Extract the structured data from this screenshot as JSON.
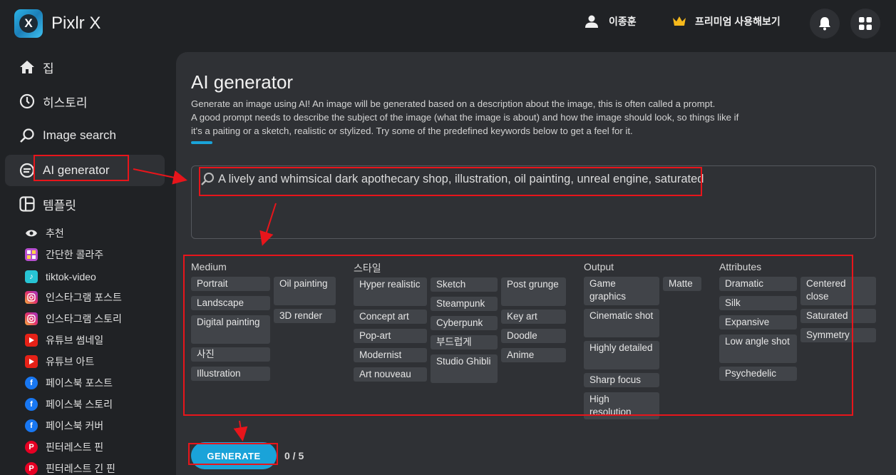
{
  "app": {
    "name": "Pixlr X",
    "logo_letter": "X"
  },
  "topbar": {
    "user_name": "이종훈",
    "premium_label": "프리미엄 사용해보기"
  },
  "sidebar": {
    "items": [
      {
        "label": "집",
        "icon": "home-icon"
      },
      {
        "label": "히스토리",
        "icon": "clock-icon"
      },
      {
        "label": "Image search",
        "icon": "search-icon"
      },
      {
        "label": "AI generator",
        "icon": "ai-icon",
        "active": true
      },
      {
        "label": "템플릿",
        "icon": "template-icon"
      }
    ],
    "templates": [
      {
        "label": "추천",
        "icon": "eye-icon"
      },
      {
        "label": "간단한 콜라주",
        "icon": "collage-icon"
      },
      {
        "label": "tiktok-video",
        "icon": "tiktok-icon"
      },
      {
        "label": "인스타그램 포스트",
        "icon": "instagram-icon"
      },
      {
        "label": "인스타그램 스토리",
        "icon": "instagram-icon"
      },
      {
        "label": "유튜브 썸네일",
        "icon": "youtube-icon"
      },
      {
        "label": "유튜브 아트",
        "icon": "youtube-icon"
      },
      {
        "label": "페이스북 포스트",
        "icon": "facebook-icon"
      },
      {
        "label": "페이스북 스토리",
        "icon": "facebook-icon"
      },
      {
        "label": "페이스북 커버",
        "icon": "facebook-icon"
      },
      {
        "label": "핀터레스트 핀",
        "icon": "pinterest-icon"
      },
      {
        "label": "핀터레스트 긴 핀",
        "icon": "pinterest-icon"
      }
    ]
  },
  "main": {
    "title": "AI generator",
    "description_1": "Generate an image using AI! An image will be generated based on a description about the image, this is often called a prompt.",
    "description_2": "A good prompt needs to describe the subject of the image (what the image is about) and how the image should look, so things like if",
    "description_3": "it's a paiting or a sketch, realistic or stylized. Try some of the predefined keywords below to get a feel for it.",
    "prompt": "A lively and whimsical dark apothecary shop, illustration, oil painting, unreal engine, saturated",
    "categories": {
      "medium": {
        "title": "Medium",
        "chips": [
          "Portrait",
          "Landscape",
          "Digital painting",
          "사진",
          "Illustration",
          "Oil painting",
          "3D render"
        ]
      },
      "style": {
        "title": "스타일",
        "chips": [
          "Hyper realistic",
          "Concept art",
          "Pop-art",
          "Modernist",
          "Art nouveau",
          "Sketch",
          "Steampunk",
          "Cyberpunk",
          "부드럽게",
          "Studio Ghibli",
          "Post grunge",
          "Key art",
          "Doodle",
          "Anime"
        ]
      },
      "output": {
        "title": "Output",
        "chips": [
          "Game graphics",
          "Cinematic shot",
          "Highly detailed",
          "Sharp focus",
          "High resolution",
          "Matte"
        ]
      },
      "attributes": {
        "title": "Attributes",
        "chips": [
          "Dramatic",
          "Silk",
          "Expansive",
          "Low angle shot",
          "Psychedelic",
          "Centered close",
          "Saturated",
          "Symmetry"
        ]
      }
    },
    "generate_label": "GENERATE",
    "counter": "0 / 5"
  },
  "colors": {
    "accent": "#1aa3d9",
    "background": "#202225",
    "panel": "#2f3135",
    "chip": "#414449",
    "annotation": "#e8151b"
  }
}
